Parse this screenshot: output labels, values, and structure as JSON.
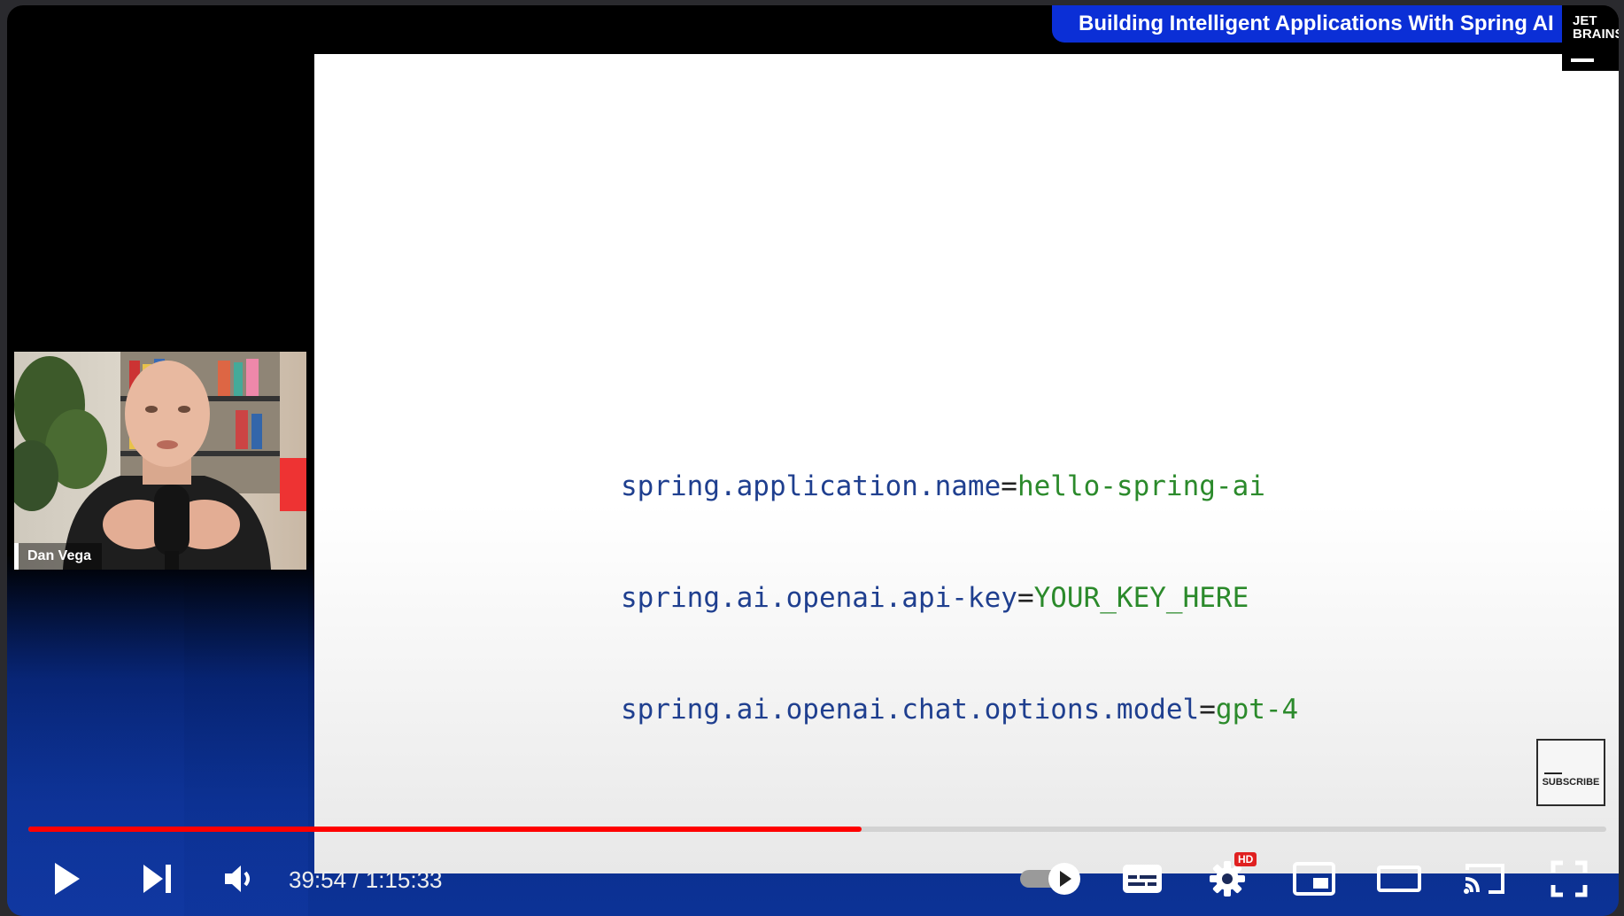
{
  "video": {
    "title_banner": "Building Intelligent Applications With Spring AI",
    "logo_lines": [
      "JET",
      "BRAINS"
    ],
    "speaker_name": "Dan Vega",
    "subscribe_label": "SUBSCRIBE"
  },
  "slide": {
    "code_lines": [
      {
        "key": "spring.application.name",
        "eq": "=",
        "value": "hello-spring-ai"
      },
      {
        "key": "spring.ai.openai.api-key",
        "eq": "=",
        "value": "YOUR_KEY_HERE"
      },
      {
        "key": "spring.ai.openai.chat.options.model",
        "eq": "=",
        "value": "gpt-4"
      }
    ]
  },
  "controls": {
    "current_time": "39:54",
    "separator": " / ",
    "duration": "1:15:33",
    "progress_fraction": 0.528,
    "hd_badge": "HD",
    "icons": [
      "play-icon",
      "next-icon",
      "volume-icon",
      "autoplay-toggle-icon",
      "subtitles-icon",
      "settings-icon",
      "miniplayer-icon",
      "theater-mode-icon",
      "cast-icon",
      "fullscreen-icon"
    ]
  },
  "colors": {
    "progress_played": "#ff0000",
    "banner": "#0b2fd6",
    "code_key": "#1f3f8f",
    "code_value": "#2b8a2b"
  }
}
